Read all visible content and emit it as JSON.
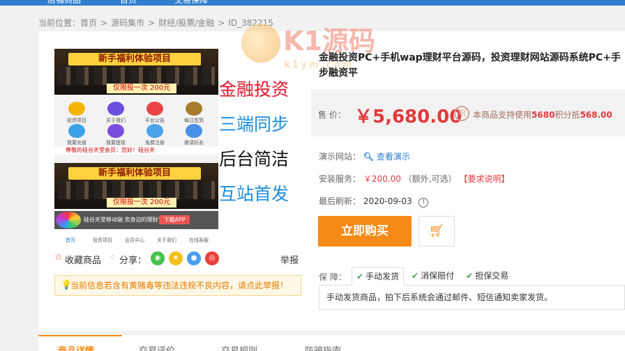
{
  "topnav": {
    "items": [
      "店铺商品",
      "首页",
      "交易保障"
    ]
  },
  "breadcrumb": {
    "prefix": "当前位置：",
    "items": [
      "首页",
      "源码集市",
      "财经/股票/金融",
      "ID_382215"
    ]
  },
  "watermark": {
    "text": "K1源码",
    "sub": "k1ym.com"
  },
  "gallery": {
    "banner_title": "新手福利体验项目",
    "banner_badge": "仅限投一次 200元",
    "icons": [
      "投资项目",
      "关于我们",
      "平台公告",
      "每日签到",
      "我要充值",
      "我要提现",
      "免费注册",
      "邀请好友"
    ],
    "marquee": "尊敬的硅谷天堂会员：您好！硅谷天",
    "download_text": "硅谷天堂移动端 您身边的理财专家",
    "download_btn": "下载APP",
    "tabbar": [
      "首页",
      "投资项目",
      "会员中心",
      "关于我们",
      "在线客服"
    ],
    "slogans": [
      "金融投资",
      "三端同步",
      "后台简洁",
      "互站首发"
    ]
  },
  "share": {
    "favorite": "收藏商品",
    "share_label": "分享：",
    "report": "举报"
  },
  "notice": "当前信息若含有黄赌毒等违法违规不良内容，请点此举报！",
  "product": {
    "title_line1": "金融投资PC+手机wap理财平台源码，投资理财网站源码系统PC+手",
    "title_line2": "步融资平",
    "price_label": "售  价：",
    "price": "￥5,680.00",
    "points_prefix": "本商品支持使用",
    "points_value": "5680",
    "points_mid": "积分抵",
    "points_amount": "568.00",
    "demo_label": "演示网站：",
    "demo_link": "查看演示",
    "install_label": "安装服务：",
    "install_price": "￥200.00",
    "install_note": "（额外,可选）",
    "install_req": "【要求说明】",
    "refresh_label": "最后刷新：",
    "refresh_date": "2020-09-03",
    "buy_label": "立即购买"
  },
  "guarantee": {
    "label": "保  障：",
    "tags": [
      "手动发货",
      "消保赔付",
      "担保交易"
    ],
    "desc": "手动发货商品，拍下后系统会通过邮件、短信通知卖家发货。"
  },
  "bottom_tabs": [
    "商品详情",
    "交易评价",
    "交易规则",
    "防骗指南"
  ]
}
